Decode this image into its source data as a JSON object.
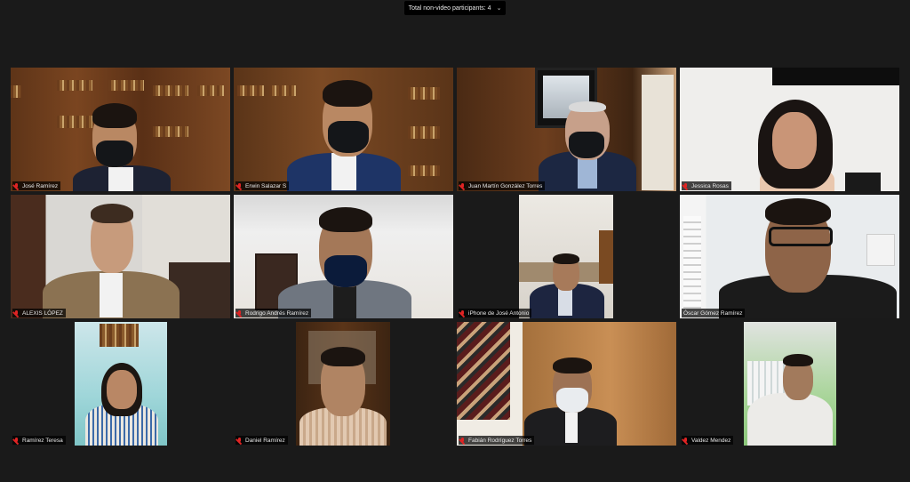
{
  "meeting": {
    "view_label": "Total non-video participants: 4",
    "dropdown_icon": "chevron-down-icon"
  },
  "participants": [
    {
      "name": "José Ramírez",
      "muted": true
    },
    {
      "name": "Erwin Salazar S",
      "muted": true
    },
    {
      "name": "Juan Martín González Torres",
      "muted": true
    },
    {
      "name": "Jessica Rosas",
      "muted": true
    },
    {
      "name": "ALEXIS LÓPEZ",
      "muted": true
    },
    {
      "name": "Rodrigo Andrés Ramírez",
      "muted": true
    },
    {
      "name": "iPhone de José Antonio",
      "muted": true
    },
    {
      "name": "Óscar Gómez Ramírez",
      "muted": false,
      "active_speaker": true
    },
    {
      "name": "Ramírez Teresa",
      "muted": true
    },
    {
      "name": "Daniel Ramírez",
      "muted": true
    },
    {
      "name": "Fabián Rodríguez Torres",
      "muted": true
    },
    {
      "name": "Valdez Mendez",
      "muted": true
    }
  ],
  "colors": {
    "background": "#1a1a1a",
    "active_speaker_border": "#e6f06a",
    "muted_icon": "#e02424"
  }
}
